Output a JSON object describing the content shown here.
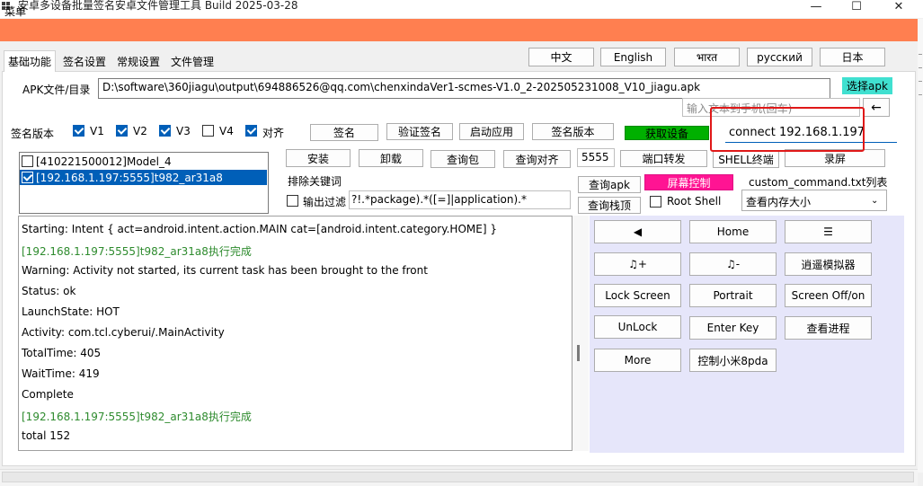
{
  "window": {
    "title": "安卓多设备批量签名安卓文件管理工具 Build 2025-03-28",
    "minimize": "—",
    "maximize": "☐",
    "close": "✕"
  },
  "menu": {
    "label": "菜单"
  },
  "tabs": [
    "基础功能",
    "签名设置",
    "常规设置",
    "文件管理"
  ],
  "languages": [
    "中文",
    "English",
    "भारत",
    "русский",
    "日本"
  ],
  "apk": {
    "label": "APK文件/目录",
    "path": "D:\\software\\360jiagu\\output\\694886526@qq.com\\chenxindaVer1-scmes-V1.0_2-202505231008_V10_jiagu.apk",
    "select_button": "选择apk"
  },
  "phone_input": {
    "placeholder": "输入文本到手机(回车)",
    "send_button": "←"
  },
  "signing": {
    "label": "签名版本",
    "options": [
      {
        "label": "V1",
        "checked": true
      },
      {
        "label": "V2",
        "checked": true
      },
      {
        "label": "V3",
        "checked": true
      },
      {
        "label": "V4",
        "checked": false
      },
      {
        "label": "对齐",
        "checked": true
      }
    ]
  },
  "actions_row1": [
    "签名",
    "验证签名",
    "启动应用",
    "签名版本"
  ],
  "get_device_button": "获取设备",
  "connect_input": "connect 192.168.1.197",
  "devices": [
    {
      "label": "[410221500012]Model_4",
      "checked": false,
      "selected": false
    },
    {
      "label": "[192.168.1.197:5555]t982_ar31a8",
      "checked": true,
      "selected": true
    }
  ],
  "actions_row2": [
    "安装",
    "卸载",
    "查询包",
    "查询对齐"
  ],
  "port_value": "5555",
  "port_forward_button": "端口转发",
  "shell_terminal_button": "SHELL终端",
  "record_button": "录屏",
  "exclude_label": "排除关键词",
  "output_filter_label": "输出过滤",
  "output_filter_checked": false,
  "filter_value": "?!.*package).*([=]|application).*",
  "query_apk_button": "查询apk",
  "screen_control_button": "屏幕控制",
  "custom_command_label": "custom_command.txt列表",
  "query_stack_button": "查询栈顶",
  "root_shell_label": "Root Shell",
  "root_shell_checked": false,
  "memory_select": "查看内存大小",
  "log_lines": [
    {
      "text": "Starting: Intent { act=android.intent.action.MAIN cat=[android.intent.category.HOME] }",
      "green": false
    },
    {
      "text": "[192.168.1.197:5555]t982_ar31a8执行完成",
      "green": true
    },
    {
      "text": "Warning: Activity not started, its current task has been brought to the front",
      "green": false
    },
    {
      "text": "Status: ok",
      "green": false
    },
    {
      "text": "LaunchState: HOT",
      "green": false
    },
    {
      "text": "Activity: com.tcl.cyberui/.MainActivity",
      "green": false
    },
    {
      "text": "TotalTime: 405",
      "green": false
    },
    {
      "text": "WaitTime: 419",
      "green": false
    },
    {
      "text": "Complete",
      "green": false
    },
    {
      "text": "[192.168.1.197:5555]t982_ar31a8执行完成",
      "green": true
    },
    {
      "text": "total 152",
      "green": false
    }
  ],
  "controls": [
    [
      "◀",
      "Home",
      "☰"
    ],
    [
      "♫+",
      "♫-",
      "逍遥模拟器"
    ],
    [
      "Lock Screen",
      "Portrait",
      "Screen Off/on"
    ],
    [
      "UnLock",
      "Enter Key",
      "查看进程"
    ],
    [
      "More",
      "控制小米8pda"
    ]
  ],
  "colors": {
    "menubar": "#ff7f50",
    "get_device": "#00b000",
    "screen_control": "#ff1493",
    "select_apk": "#40e0d0",
    "control_panel": "#e6e6fa",
    "selection": "#005fb8",
    "log_green": "#2e8b2e",
    "highlight_box": "#e01818"
  }
}
